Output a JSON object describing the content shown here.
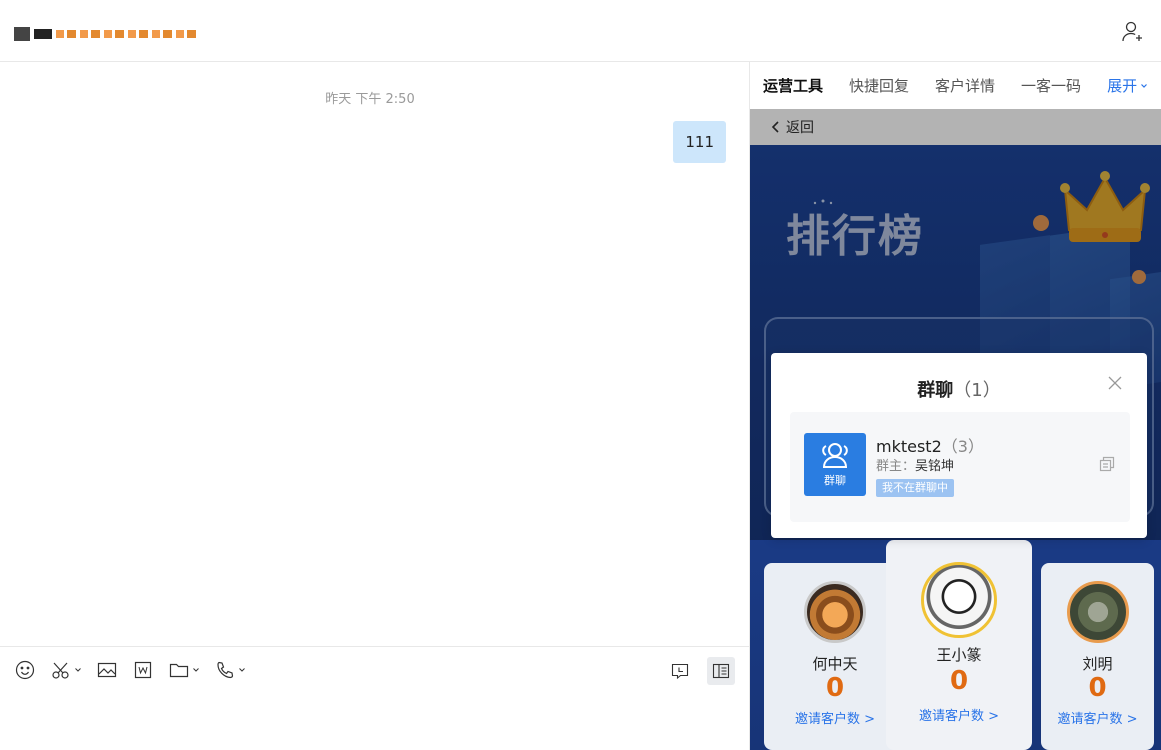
{
  "header": {
    "contact_name_redacted": true
  },
  "chat": {
    "timestamp": "昨天 下午 2:50",
    "messages": [
      {
        "from": "me",
        "text": "111"
      }
    ]
  },
  "composer": {
    "tools": [
      "emoji-icon",
      "scissors-icon",
      "image-icon",
      "word-icon",
      "folder-icon",
      "phone-icon"
    ],
    "right_tools": [
      "message-box-icon",
      "sidebar-panel-icon"
    ]
  },
  "panel": {
    "tabs": [
      {
        "label": "运营工具",
        "active": true
      },
      {
        "label": "快捷回复",
        "active": false
      },
      {
        "label": "客户详情",
        "active": false
      },
      {
        "label": "一客一码",
        "active": false
      }
    ],
    "expand_label": "展开",
    "back_label": "返回",
    "rank_title": "排行榜",
    "leaders": [
      {
        "name": "何中天",
        "count": "0",
        "invite_label": "邀请客户数 >"
      },
      {
        "name": "王小篆",
        "count": "0",
        "invite_label": "邀请客户数 >"
      },
      {
        "name": "刘明",
        "count": "0",
        "invite_label": "邀请客户数 >"
      }
    ]
  },
  "modal": {
    "title": "群聊",
    "title_count": "（1）",
    "group": {
      "name": "mktest2",
      "member_count": "（3）",
      "owner_label": "群主：",
      "owner": "吴铭坤",
      "badge": "我不在群聊中",
      "avatar_label": "群聊"
    }
  },
  "colors": {
    "accent": "#2a74e8",
    "bubble": "#cde6fb",
    "rank_bg": "#1f4aa6",
    "count": "#e06a12"
  }
}
